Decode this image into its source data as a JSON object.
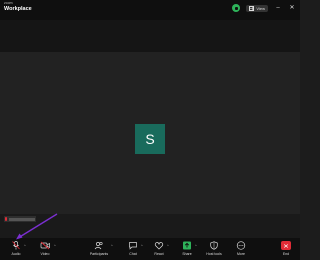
{
  "window": {
    "brand_small": "zoom",
    "brand_big": "Workplace",
    "view_label": "View"
  },
  "meeting": {
    "avatar_initial": "S",
    "avatar_color": "#196b5c"
  },
  "toolbar": {
    "audio": "Audio",
    "video": "Video",
    "participants": "Participants",
    "chat": "Chat",
    "react": "React",
    "share": "Share",
    "host_tools": "Host tools",
    "more": "More",
    "end": "End"
  },
  "colors": {
    "accent_green": "#2eb35a",
    "end_red": "#e02c37",
    "annotation_arrow": "#7b2fd1"
  },
  "icons": [
    "shield-icon",
    "grid-icon",
    "minimize-icon",
    "close-icon",
    "microphone-icon",
    "video-icon",
    "participants-icon",
    "chat-icon",
    "react-icon",
    "share-icon",
    "host-tools-icon",
    "more-icon",
    "end-icon",
    "pointer-arrow-icon"
  ]
}
